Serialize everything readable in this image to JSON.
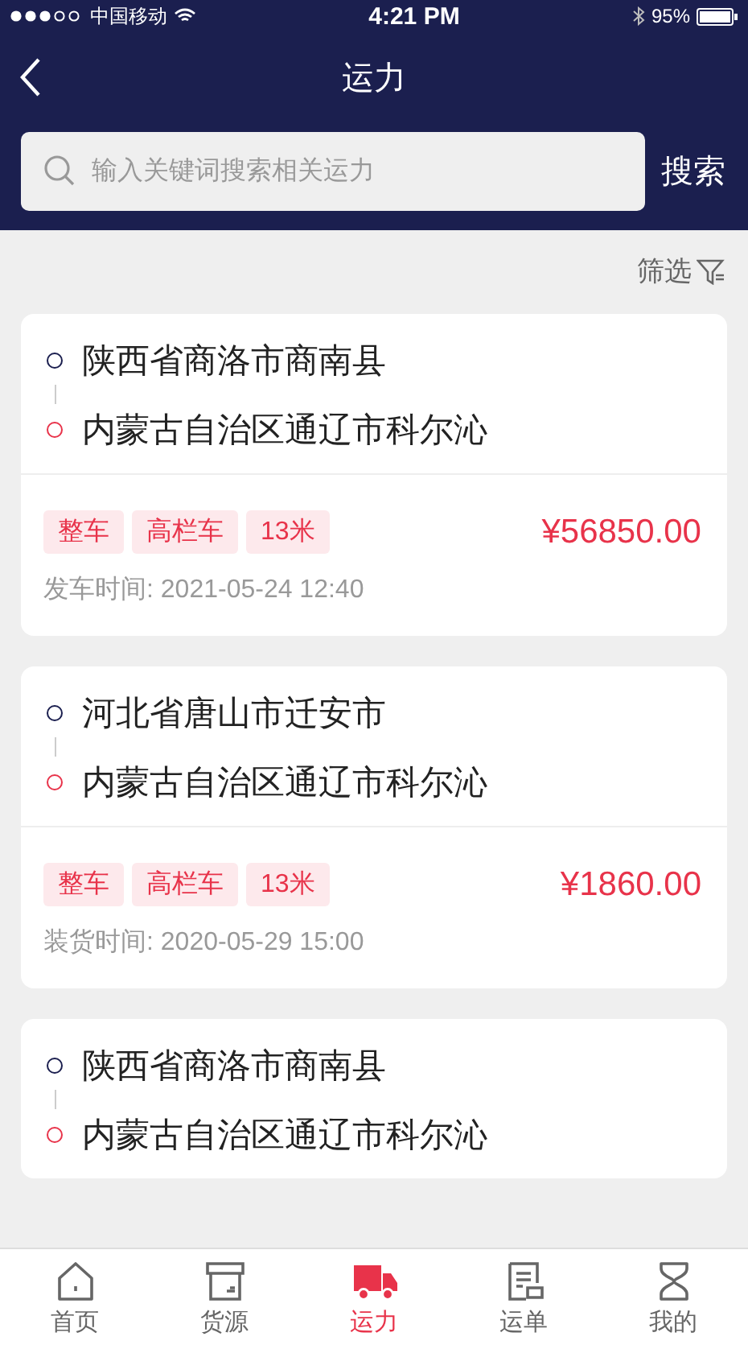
{
  "status_bar": {
    "carrier": "中国移动",
    "time": "4:21 PM",
    "battery": "95%"
  },
  "nav": {
    "title": "运力"
  },
  "search": {
    "placeholder": "输入关键词搜索相关运力",
    "button": "搜索"
  },
  "filter": {
    "label": "筛选"
  },
  "cards": [
    {
      "origin": "陕西省商洛市商南县",
      "destination": "内蒙古自治区通辽市科尔沁",
      "tags": [
        "整车",
        "高栏车",
        "13米"
      ],
      "price": "¥56850.00",
      "time_label": "发车时间:",
      "time": "2021-05-24 12:40"
    },
    {
      "origin": "河北省唐山市迁安市",
      "destination": "内蒙古自治区通辽市科尔沁",
      "tags": [
        "整车",
        "高栏车",
        "13米"
      ],
      "price": "¥1860.00",
      "time_label": "装货时间:",
      "time": "2020-05-29 15:00"
    },
    {
      "origin": "陕西省商洛市商南县",
      "destination": "内蒙古自治区通辽市科尔沁"
    }
  ],
  "tab_bar": [
    {
      "kind": "home",
      "label": "首页",
      "selected": false
    },
    {
      "kind": "box",
      "label": "货源",
      "selected": false
    },
    {
      "kind": "truck",
      "label": "运力",
      "selected": true
    },
    {
      "kind": "list",
      "label": "运单",
      "selected": false
    },
    {
      "kind": "person",
      "label": "我的",
      "selected": false
    }
  ]
}
